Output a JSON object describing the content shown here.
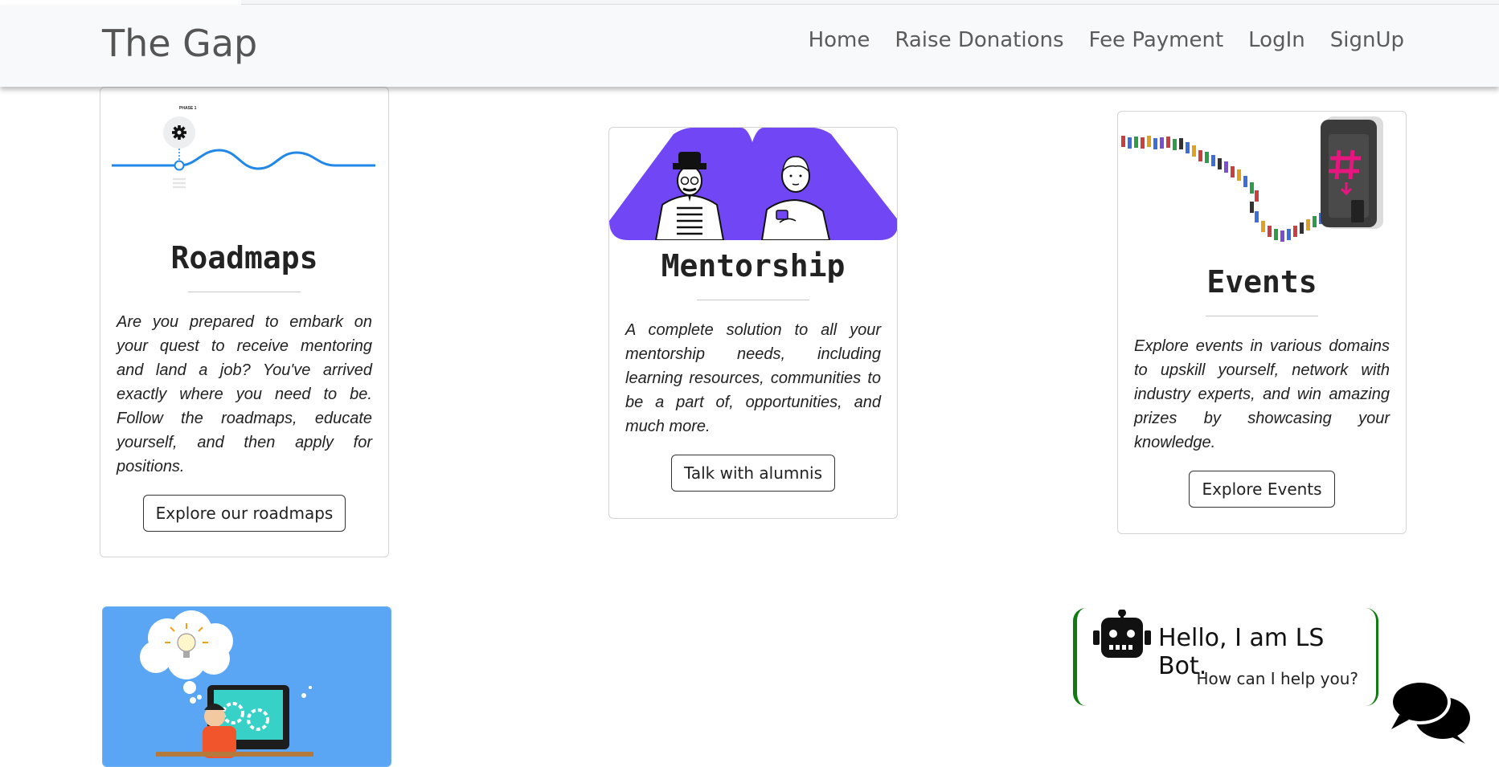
{
  "navbar": {
    "brand": "The Gap",
    "links": [
      "Home",
      "Raise Donations",
      "Fee Payment",
      "LogIn",
      "SignUp"
    ]
  },
  "cards": [
    {
      "title": "Roadmaps",
      "text": "Are you prepared to embark on your quest to receive mentoring and land a job? You've arrived exactly where you need to be. Follow the roadmaps, educate yourself, and then apply for positions.",
      "button": "Explore our roadmaps",
      "image_label": "PHASE 1"
    },
    {
      "title": "Mentorship",
      "text": "A complete solution to all your mentorship needs, including learning resources, communities to be a part of, opportunities, and much more.",
      "button": "Talk with alumnis"
    },
    {
      "title": "Events",
      "text": "Explore events in various domains to upskill yourself, network with industry experts, and win amazing prizes by showcasing your knowledge.",
      "button": "Explore Events"
    }
  ],
  "chatbot": {
    "title": "Hello, I am LS Bot.",
    "subtitle": "How can I help you?",
    "icon": "robot-icon",
    "toggle_icon": "chat-bubbles-icon"
  },
  "colors": {
    "navbar_bg": "#f8f9fa",
    "mentorship_purple": "#7147f5",
    "events_pink": "#e6157f",
    "roadmap_blue": "#2288e8",
    "bot_border": "#0f7c0f",
    "ideas_card_bg": "#5aa6f5"
  }
}
